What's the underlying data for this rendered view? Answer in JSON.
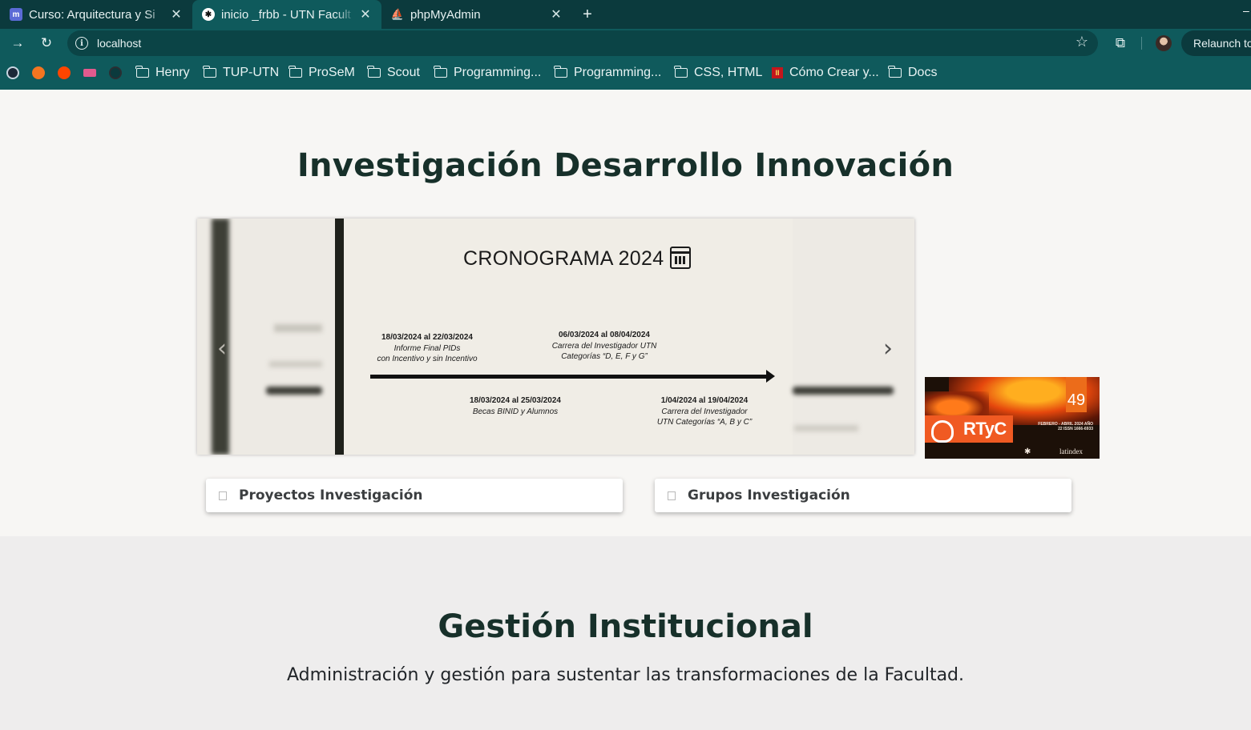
{
  "browser": {
    "tabs": [
      {
        "title": "Curso: Arquitectura y Si",
        "active": false
      },
      {
        "title": "inicio _frbb - UTN Facult",
        "active": true
      },
      {
        "title": "phpMyAdmin",
        "active": false
      }
    ],
    "new_tab_label": "+",
    "url": "localhost",
    "relaunch_label": "Relaunch to",
    "bookmarks": [
      "Henry",
      "TUP-UTN",
      "ProSeM",
      "Scout",
      "Programming...",
      "Programming...",
      "CSS, HTML",
      "Cómo Crear y...",
      "Docs"
    ]
  },
  "section1": {
    "title": "Investigación Desarrollo Innovación",
    "slide": {
      "title": "CRONOGRAMA 2024",
      "events": [
        {
          "dates": "18/03/2024 al 22/03/2024",
          "line1": "Informe Final PIDs",
          "line2": "con Incentivo y sin Incentivo"
        },
        {
          "dates": "06/03/2024 al 08/04/2024",
          "line1": "Carrera del Investigador UTN",
          "line2": "Categorías “D, E, F y G”"
        },
        {
          "dates": "18/03/2024 al 25/03/2024",
          "line1": "Becas BINID y Alumnos",
          "line2": ""
        },
        {
          "dates": "1/04/2024 al 19/04/2024",
          "line1": "Carrera del Investigador",
          "line2": "UTN Categorías “A, B y C”"
        }
      ]
    },
    "side_banner": {
      "issue": "49",
      "logo": "RTyC",
      "info": "FEBRERO - ABRIL 2024 AÑO 22 ISSN 1666-6933",
      "indexer": "latindex"
    },
    "cards": [
      {
        "label": "Proyectos Investigación"
      },
      {
        "label": "Grupos Investigación"
      }
    ]
  },
  "section2": {
    "title": "Gestión Institucional",
    "subtitle": "Administración y gestión para sustentar las transformaciones de la Facultad."
  },
  "colors": {
    "tabbar_bg": "#0b3a3d",
    "toolbar_bg": "#0f5a5c",
    "heading": "#17302a",
    "section1_bg": "#f7f6f4",
    "section2_bg": "#eeeded",
    "rtyc_orange": "#f05a22"
  }
}
